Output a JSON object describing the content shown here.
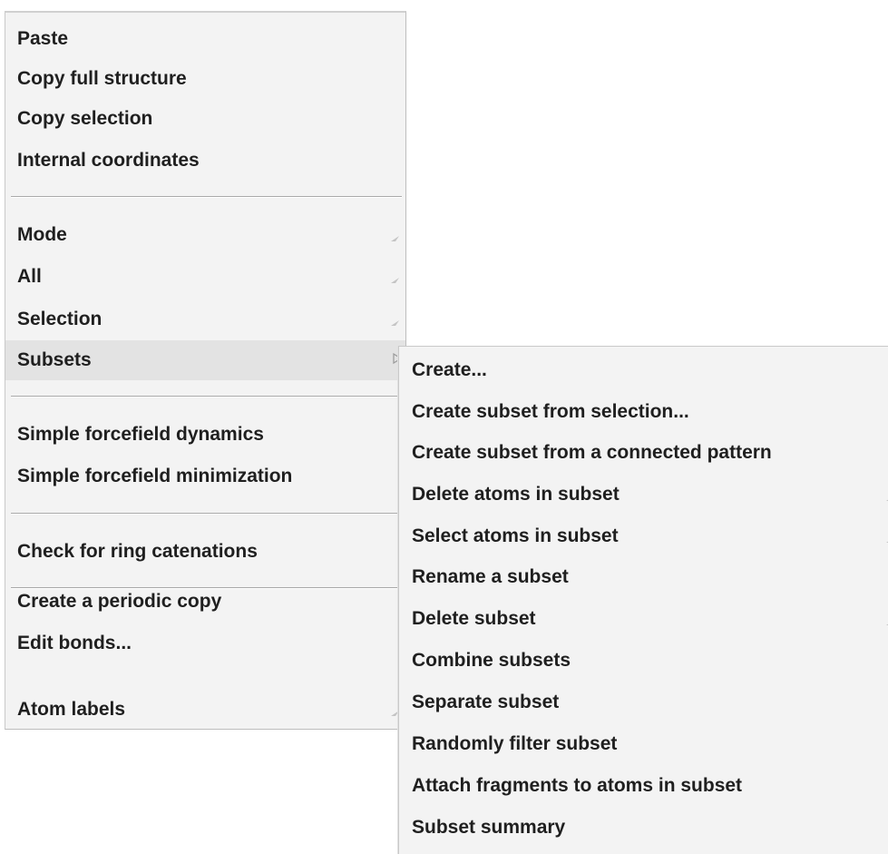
{
  "main_menu": {
    "group1": [
      "Paste",
      "Copy full structure",
      "Copy selection",
      "Internal coordinates"
    ],
    "group2": [
      "Mode",
      "All",
      "Selection",
      "Subsets"
    ],
    "group3": [
      "Simple forcefield dynamics",
      "Simple forcefield minimization"
    ],
    "group4": [
      "Check for ring catenations"
    ],
    "group5": [
      "Create a periodic copy",
      "Edit bonds...",
      "Atom labels"
    ]
  },
  "submenu": {
    "items": [
      "Create...",
      "Create subset from selection...",
      "Create subset from a connected pattern",
      "Delete atoms in subset",
      "Select atoms in subset",
      "Rename a subset",
      "Delete subset",
      "Combine subsets",
      "Separate subset",
      "Randomly filter subset",
      "Attach fragments to atoms in subset",
      "Subset summary"
    ]
  },
  "highlighted_item": "Subsets",
  "icons": {
    "submenu_arrow": "submenu-arrow-icon"
  },
  "colors": {
    "menu_bg": "#f3f3f3",
    "highlight_bg": "#e3e3e3",
    "text": "#1f1f1f",
    "separator": "#a9a9a9"
  }
}
